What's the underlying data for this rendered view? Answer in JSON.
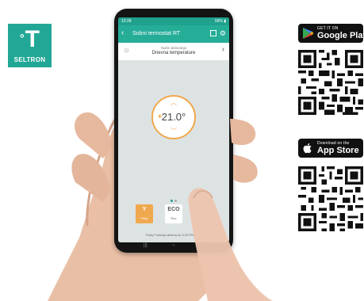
{
  "logo": {
    "symbol": "T",
    "degree": "°",
    "brand": "SELTRON",
    "color": "#22a796"
  },
  "stores": {
    "google": {
      "small": "GET IT ON",
      "big": "Google Play",
      "icon": "play-icon"
    },
    "apple": {
      "small": "Download on the",
      "big": "App Store",
      "icon": "apple-icon"
    }
  },
  "app": {
    "status_time": "10:28",
    "status_right": "99% ▮",
    "title": "Sobni termostat RT",
    "mode_label": "Način delovanja",
    "mode_value": "Dnevna temperature",
    "temperature": "21.0°",
    "buttons": [
      {
        "glyph": "Y",
        "label": "Party"
      },
      {
        "glyph": "ECO",
        "label": "Eco"
      }
    ],
    "footer_note": "Party Funkcija aktivna do 0:25 PM da…",
    "accent": "#25ad98",
    "highlight": "#f0a84e"
  }
}
